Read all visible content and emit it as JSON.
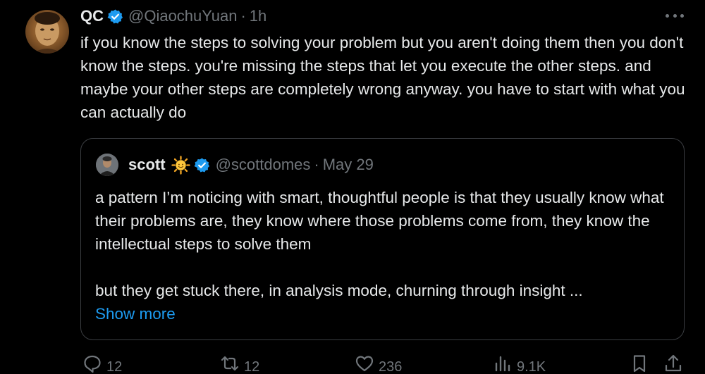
{
  "tweet": {
    "display_name": "QC",
    "handle": "@QiaochuYuan",
    "separator": "·",
    "time": "1h",
    "text": "if you know the steps to solving your problem but you aren't doing them then you don't know the steps. you're missing the steps that let you execute the other steps. and maybe your other steps are completely wrong anyway. you have to start with what you can actually do"
  },
  "quote": {
    "display_name": "scott",
    "handle": "@scottdomes",
    "separator": "·",
    "date": "May 29",
    "paragraph1": "a pattern I’m noticing with smart, thoughtful people is that they usually know what their problems are, they know where those problems come from, they know the intellectual steps to solve them",
    "paragraph2": "but they get stuck there, in analysis mode, churning through insight ...",
    "show_more": "Show more"
  },
  "actions": {
    "replies": "12",
    "reposts": "12",
    "likes": "236",
    "views": "9.1K"
  },
  "colors": {
    "background": "#000000",
    "text": "#e7e9ea",
    "muted": "#71767b",
    "accent": "#1d9bf0",
    "border": "#3a3d41",
    "verified": "#1d9bf0"
  },
  "icons": {
    "verified": "verified-badge-icon",
    "sun_emoji": "sun-emoji-icon",
    "more": "more-dots-icon",
    "reply": "reply-icon",
    "repost": "repost-icon",
    "like": "heart-icon",
    "views": "views-icon",
    "bookmark": "bookmark-icon",
    "share": "share-icon"
  }
}
